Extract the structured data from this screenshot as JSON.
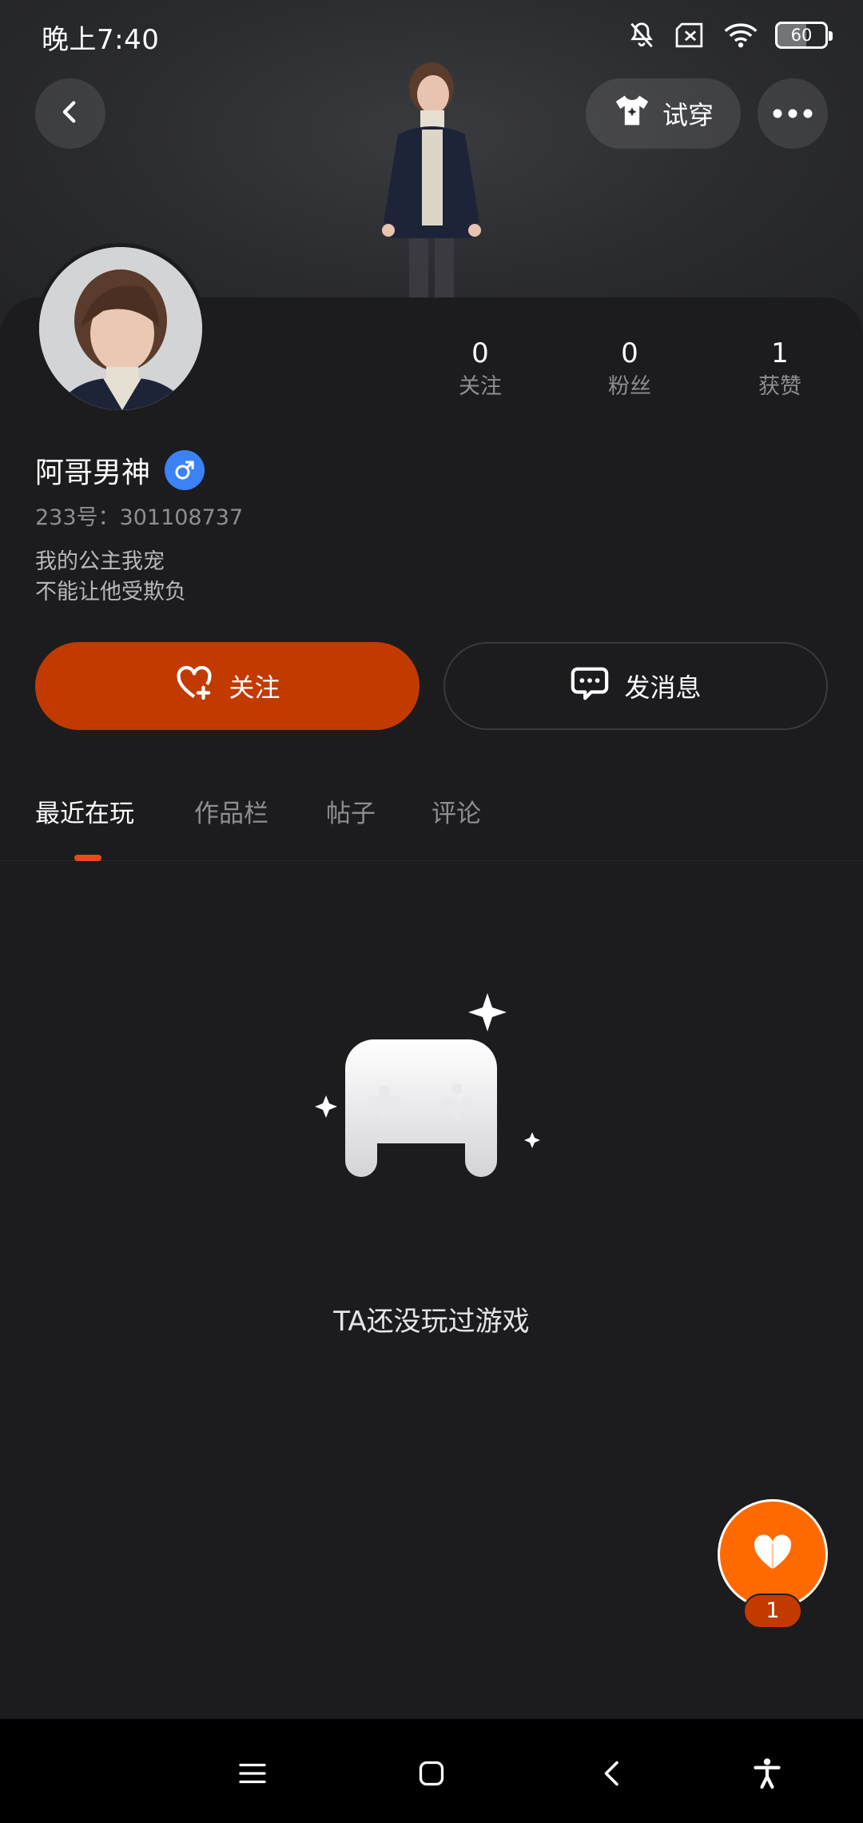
{
  "status_bar": {
    "time": "晚上7:40",
    "battery": "60",
    "icons": [
      "bell-off-icon",
      "sim-x-icon",
      "wifi-icon",
      "battery-icon"
    ]
  },
  "header": {
    "tryon_label": "试穿",
    "icons": [
      "back-icon",
      "shirt-sparkle-icon",
      "more-icon"
    ]
  },
  "profile": {
    "name": "阿哥男神",
    "gender": "male",
    "uid": "233号：301108737",
    "bio_line1": "我的公主我宠",
    "bio_line2": "不能让他受欺负"
  },
  "stats": [
    {
      "value": "0",
      "label": "关注"
    },
    {
      "value": "0",
      "label": "粉丝"
    },
    {
      "value": "1",
      "label": "获赞"
    }
  ],
  "actions": {
    "follow_label": "关注",
    "message_label": "发消息"
  },
  "tabs": [
    {
      "label": "最近在玩",
      "active": true
    },
    {
      "label": "作品栏",
      "active": false
    },
    {
      "label": "帖子",
      "active": false
    },
    {
      "label": "评论",
      "active": false
    }
  ],
  "empty_state": {
    "text": "TA还没玩过游戏",
    "icon": "gamepad-icon"
  },
  "like_fab": {
    "count": "1",
    "icon": "heart-icon"
  },
  "nav_bar": {
    "icons": [
      "menu-icon",
      "home-square-icon",
      "back-chevron-icon",
      "accessibility-icon"
    ]
  },
  "colors": {
    "accent": "#c23a00",
    "fab": "#ff6a00",
    "tab_indicator": "#e54a1b",
    "gender_badge": "#3b82f6",
    "background": "#1c1c1e"
  }
}
